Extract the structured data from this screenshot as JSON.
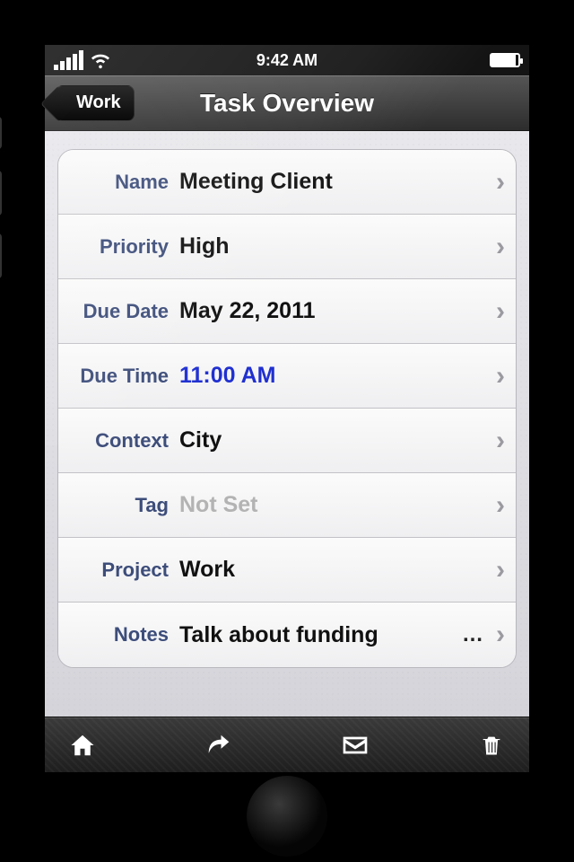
{
  "statusbar": {
    "time": "9:42 AM"
  },
  "nav": {
    "back_label": "Work",
    "title": "Task Overview"
  },
  "rows": [
    {
      "label": "Name",
      "value": "Meeting Client",
      "style": "normal"
    },
    {
      "label": "Priority",
      "value": "High",
      "style": "normal"
    },
    {
      "label": "Due Date",
      "value": "May 22, 2011",
      "style": "normal"
    },
    {
      "label": "Due Time",
      "value": "11:00 AM",
      "style": "link"
    },
    {
      "label": "Context",
      "value": "City",
      "style": "normal"
    },
    {
      "label": "Tag",
      "value": "Not Set",
      "style": "placeholder"
    },
    {
      "label": "Project",
      "value": "Work",
      "style": "normal"
    },
    {
      "label": "Notes",
      "value": "Talk about funding",
      "style": "normal",
      "truncated": true
    }
  ],
  "toolbar": {
    "home_icon": "home",
    "share_icon": "share",
    "mail_icon": "mail",
    "trash_icon": "trash"
  }
}
